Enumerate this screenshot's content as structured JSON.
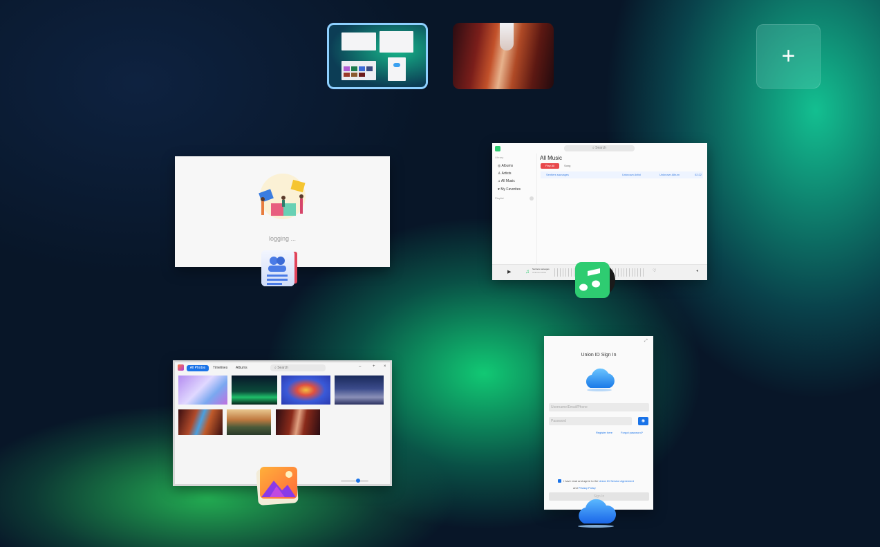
{
  "workspaces": {
    "add_label": "+"
  },
  "contacts_window": {
    "status_text": "logging ..."
  },
  "music_window": {
    "search_placeholder": "Search",
    "title": "All Music",
    "play_all_label": "Play All",
    "sort_label": "Song",
    "sidebar_header": "Library",
    "sidebar_items": [
      "Albums",
      "Artists",
      "All Music",
      "My Favorites"
    ],
    "playlist_label": "Playlist",
    "track": {
      "title": "Sentiers sauvages",
      "artist": "Unknown Artist",
      "album": "Unknown Album",
      "duration": "02:22"
    },
    "now_playing": {
      "title": "Sentiers sauvages",
      "artist": "Unknown Artist"
    }
  },
  "photos_window": {
    "tabs": [
      "All Photos",
      "Timelines",
      "Albums"
    ],
    "search_placeholder": "Search"
  },
  "signin_window": {
    "title": "Union ID Sign In",
    "username_placeholder": "Username/Email/Phone",
    "password_placeholder": "Password",
    "register_label": "Register here",
    "forgot_label": "Forgot password?",
    "agree_prefix": "I have read and agree to the",
    "agree_link1": "Union ID Service Agreement",
    "agree_and": "and",
    "agree_link2": "Privacy Policy",
    "signin_button": "Sign In"
  },
  "colors": {
    "accent": "#1a73e8",
    "music_green": "#2ecc71",
    "play_all_red": "#e8484c",
    "workspace_active_border": "#8ed0ff"
  },
  "icons": {
    "contacts": "contacts-app-icon",
    "music": "music-app-icon",
    "photos": "photos-app-icon",
    "cloud": "cloud-app-icon"
  }
}
